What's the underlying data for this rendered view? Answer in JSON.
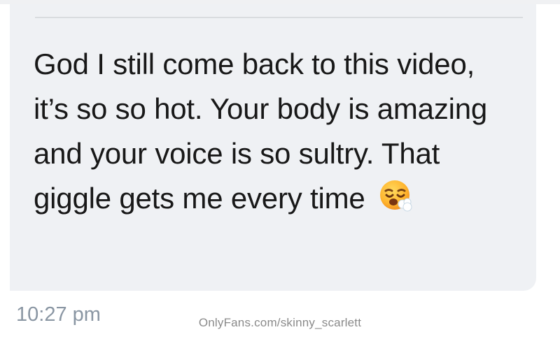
{
  "message": {
    "text": "God I still come back to this video, it’s so so hot. Your body is amazing and your voice is so sultry. That giggle gets me every time",
    "emoji": "😮‍💨",
    "timestamp": "10:27 pm"
  },
  "watermark": {
    "text": "OnlyFans.com/skinny_scarlett"
  },
  "colors": {
    "bubble_background": "#eff1f4",
    "message_text": "#181818",
    "timestamp": "#8a96a3",
    "watermark": "#8a8a8a"
  }
}
